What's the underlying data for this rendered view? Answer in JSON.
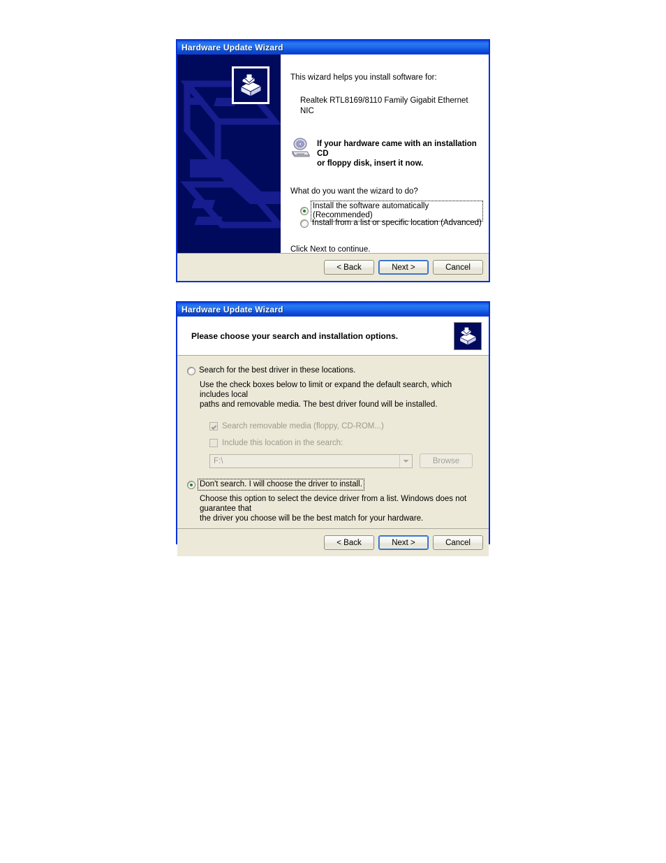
{
  "document": {
    "background": "#ffffff"
  },
  "colors": {
    "title_bar_blue": "#0a4fd6",
    "dialog_border": "#0831d9",
    "dialog_face": "#ece9d8",
    "sidebar_navy": "#000a5c",
    "sidebar_art_blue": "#161b8c",
    "radio_dot_green": "#1a8a1a",
    "disabled_text": "#9d9a8f"
  },
  "welcome_dialog": {
    "title": "Hardware Update Wizard",
    "sidebar_icon_name": "hardware-wizard-icon",
    "intro_text": "This wizard helps you install software for:",
    "device_name": "Realtek RTL8169/8110 Family Gigabit Ethernet NIC",
    "cd_icon_name": "cd-drive-icon",
    "cd_notice_line1": "If your hardware came with an installation CD",
    "cd_notice_line2": "or floppy disk, insert it now.",
    "question": "What do you want the wizard to do?",
    "options": [
      {
        "label": "Install the software automatically (Recommended)",
        "selected": true,
        "focused": true
      },
      {
        "label": "Install from a list or specific location (Advanced)",
        "selected": false,
        "focused": false
      }
    ],
    "closing_text": "Click Next to continue.",
    "buttons": {
      "back": "< Back",
      "next": "Next >",
      "cancel": "Cancel",
      "default_button": "next"
    }
  },
  "options_dialog": {
    "title": "Hardware Update Wizard",
    "header_title": "Please choose your search and installation options.",
    "header_icon_name": "hardware-wizard-icon",
    "option_search": {
      "label": "Search for the best driver in these locations.",
      "selected": false,
      "description_line1": "Use the check boxes below to limit or expand the default search, which includes local",
      "description_line2": "paths and removable media. The best driver found will be installed."
    },
    "checkbox_removable": {
      "label": "Search removable media (floppy, CD-ROM...)",
      "checked": true,
      "enabled": false
    },
    "checkbox_location": {
      "label": "Include this location in the search:",
      "checked": false,
      "enabled": false
    },
    "location_combo": {
      "value": "F:\\",
      "enabled": false
    },
    "browse_button": {
      "label": "Browse",
      "enabled": false
    },
    "option_manual": {
      "label": "Don't search. I will choose the driver to install.",
      "selected": true,
      "focused": true,
      "description_line1": "Choose this option to select the device driver from a list.  Windows does not guarantee that",
      "description_line2": "the driver you choose will be the best match for your hardware."
    },
    "buttons": {
      "back": "< Back",
      "next": "Next >",
      "cancel": "Cancel",
      "default_button": "next"
    }
  }
}
